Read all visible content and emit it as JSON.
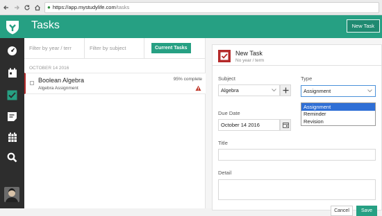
{
  "browser": {
    "url_host": "https://app.mystudylife.com",
    "url_path": "/tasks"
  },
  "header": {
    "title": "Tasks",
    "new_task_label": "New Task"
  },
  "sidebar": {
    "items": [
      {
        "icon": "dashboard-icon"
      },
      {
        "icon": "calendar-icon"
      },
      {
        "icon": "tasks-check-icon"
      },
      {
        "icon": "exams-icon"
      },
      {
        "icon": "schedule-grid-icon"
      },
      {
        "icon": "search-icon"
      }
    ]
  },
  "filters": {
    "year_placeholder": "Filter by year / terr",
    "subject_placeholder": "Filter by subject",
    "current_tasks_label": "Current Tasks"
  },
  "task_list": {
    "group_date": "OCTOBER 14 2016",
    "tasks": [
      {
        "title": "Boolean Algebra",
        "subtitle": "Algebra Assignment",
        "progress": "95% complete"
      }
    ]
  },
  "form": {
    "title": "New Task",
    "subtitle": "No year / term",
    "subject_label": "Subject",
    "subject_value": "Algebra",
    "type_label": "Type",
    "type_value": "Assignment",
    "type_options": [
      "Assignment",
      "Reminder",
      "Revision"
    ],
    "due_date_label": "Due Date",
    "due_date_value": "October 14 2016",
    "title_label": "Title",
    "detail_label": "Detail",
    "cancel_label": "Cancel",
    "save_label": "Save"
  },
  "colors": {
    "brand_green": "#26a083",
    "task_red": "#b52a2a",
    "sidebar_dark": "#2d2d2d",
    "selection_blue": "#2f6fd6"
  }
}
